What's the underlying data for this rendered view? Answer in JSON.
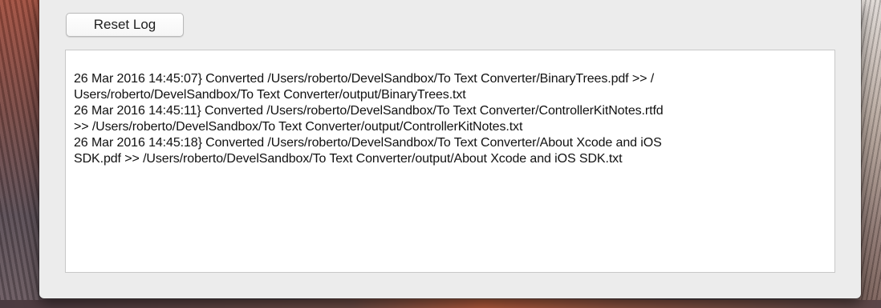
{
  "toolbar": {
    "reset_label": "Reset Log"
  },
  "log": {
    "lines": [
      "26 Mar 2016 14:45:07} Converted /Users/roberto/DevelSandbox/To Text Converter/BinaryTrees.pdf  >>  /",
      "Users/roberto/DevelSandbox/To Text Converter/output/BinaryTrees.txt",
      "26 Mar 2016 14:45:11} Converted /Users/roberto/DevelSandbox/To Text Converter/ControllerKitNotes.rtfd",
      ">>  /Users/roberto/DevelSandbox/To Text Converter/output/ControllerKitNotes.txt",
      "26 Mar 2016 14:45:18} Converted /Users/roberto/DevelSandbox/To Text Converter/About Xcode and iOS",
      "SDK.pdf  >>  /Users/roberto/DevelSandbox/To Text Converter/output/About Xcode and iOS SDK.txt"
    ]
  },
  "colors": {
    "window_background": "#ececec",
    "log_background": "#ffffff",
    "text": "#111111"
  }
}
